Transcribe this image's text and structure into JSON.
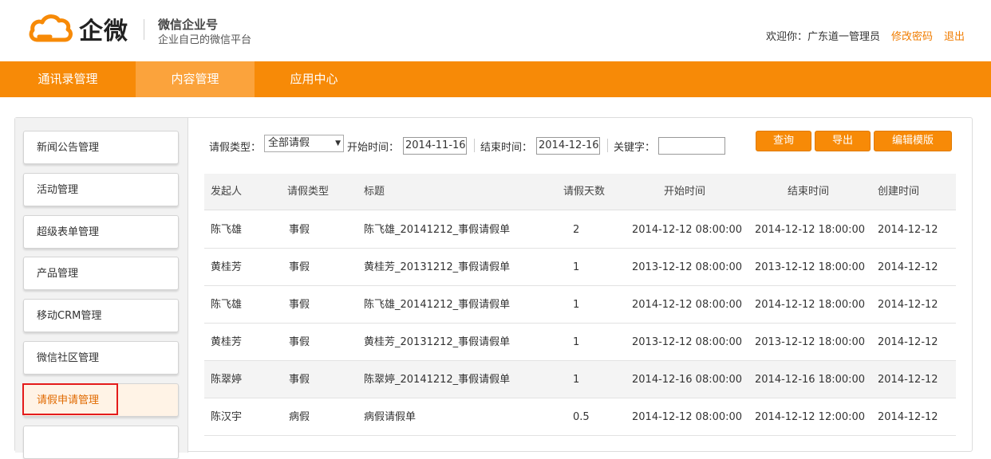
{
  "header": {
    "brand": "企微",
    "brand_title": "微信企业号",
    "brand_subtitle": "企业自己的微信平台",
    "welcome": "欢迎你：广东道一管理员",
    "change_password": "修改密码",
    "logout": "退出",
    "logo_icon": "cloud-logo-icon",
    "accent_color": "#f78a07"
  },
  "nav": {
    "items": [
      {
        "label": "通讯录管理"
      },
      {
        "label": "内容管理"
      },
      {
        "label": "应用中心"
      }
    ],
    "active": "内容管理"
  },
  "sidebar": {
    "items": [
      {
        "label": "新闻公告管理"
      },
      {
        "label": "活动管理"
      },
      {
        "label": "超级表单管理"
      },
      {
        "label": "产品管理"
      },
      {
        "label": "移动CRM管理"
      },
      {
        "label": "微信社区管理"
      },
      {
        "label": "请假申请管理"
      }
    ],
    "active": "请假申请管理"
  },
  "filters": {
    "type_label": "请假类型：",
    "type_value": "全部请假",
    "start_label": "开始时间：",
    "start_value": "2014-11-16",
    "end_label": "结束时间：",
    "end_value": "2014-12-16",
    "keyword_label": "关键字：",
    "keyword_value": ""
  },
  "buttons": {
    "query": "查询",
    "export": "导出",
    "edit_template": "编辑模版"
  },
  "table": {
    "headers": [
      "发起人",
      "请假类型",
      "标题",
      "请假天数",
      "开始时间",
      "结束时间",
      "创建时间"
    ],
    "rows": [
      [
        "陈飞雄",
        "事假",
        "陈飞雄_20141212_事假请假单",
        "2",
        "2014-12-12 08:00:00",
        "2014-12-12 18:00:00",
        "2014-12-12"
      ],
      [
        "黄桂芳",
        "事假",
        "黄桂芳_20131212_事假请假单",
        "1",
        "2013-12-12 08:00:00",
        "2013-12-12 18:00:00",
        "2014-12-12"
      ],
      [
        "陈飞雄",
        "事假",
        "陈飞雄_20141212_事假请假单",
        "1",
        "2014-12-12 08:00:00",
        "2014-12-12 18:00:00",
        "2014-12-12"
      ],
      [
        "黄桂芳",
        "事假",
        "黄桂芳_20131212_事假请假单",
        "1",
        "2013-12-12 08:00:00",
        "2013-12-12 18:00:00",
        "2014-12-12"
      ],
      [
        "陈翠婷",
        "事假",
        "陈翠婷_20141212_事假请假单",
        "1",
        "2014-12-16 08:00:00",
        "2014-12-16 18:00:00",
        "2014-12-12"
      ],
      [
        "陈汉宇",
        "病假",
        "病假请假单",
        "0.5",
        "2014-12-12 08:00:00",
        "2014-12-12 12:00:00",
        "2014-12-12"
      ]
    ]
  }
}
